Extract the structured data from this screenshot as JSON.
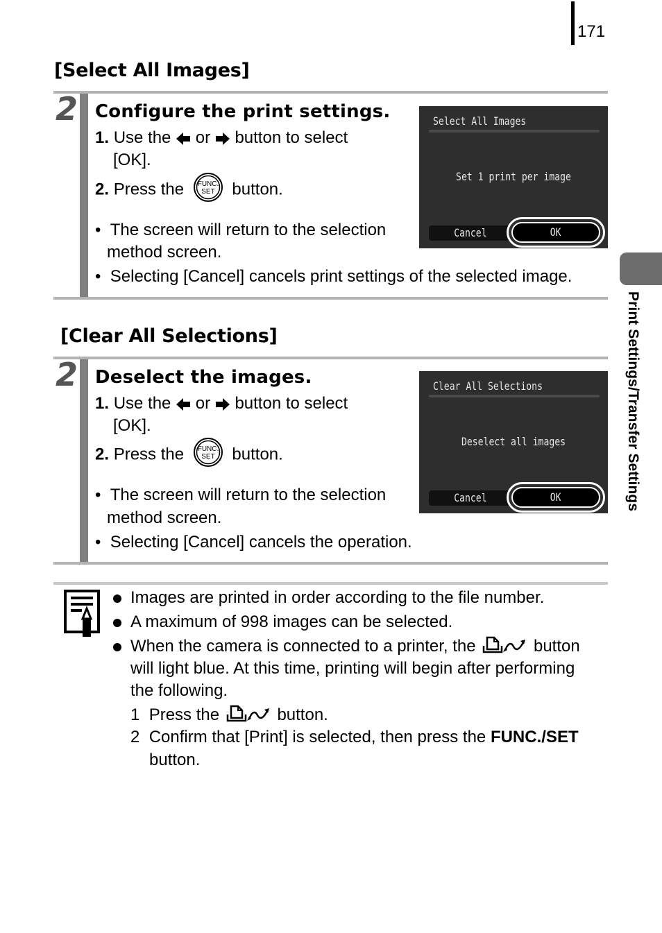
{
  "page_number": "171",
  "side_tab_label": "Print Settings/Transfer Settings",
  "sections": [
    {
      "heading": "[Select All Images]",
      "step_number": "2",
      "step_title": "Configure the print settings.",
      "instr1_num": "1.",
      "instr1_pre": "Use the",
      "instr1_or": "or",
      "instr1_post": "button to select",
      "instr1_cont": "[OK].",
      "instr2_num": "2.",
      "instr2_pre": "Press the",
      "instr2_post": "button.",
      "bullet1_a": "The screen will return to the selection",
      "bullet1_b": "method screen.",
      "bullet2": "Selecting [Cancel] cancels print settings of the selected image.",
      "screen": {
        "title": "Select All Images",
        "message": "Set 1 print per image",
        "cancel_label": "Cancel",
        "ok_label": "OK"
      }
    },
    {
      "heading": "[Clear All Selections]",
      "step_number": "2",
      "step_title": "Deselect the images.",
      "instr1_num": "1.",
      "instr1_pre": "Use the",
      "instr1_or": "or",
      "instr1_post": "button to select",
      "instr1_cont": "[OK].",
      "instr2_num": "2.",
      "instr2_pre": "Press the",
      "instr2_post": "button.",
      "bullet1_a": "The screen will return to the selection",
      "bullet1_b": "method screen.",
      "bullet2": "Selecting [Cancel] cancels the operation.",
      "screen": {
        "title": "Clear All Selections",
        "message": "Deselect all images",
        "cancel_label": "Cancel",
        "ok_label": "OK"
      }
    }
  ],
  "icons": {
    "left_arrow": "left-arrow-button-icon",
    "right_arrow": "right-arrow-button-icon",
    "func_set": "func-set-button-icon",
    "func_set_text_top": "FUNC.",
    "func_set_text_bottom": "SET",
    "print_share": "print-share-button-icon",
    "note": "note-pencil-icon"
  },
  "notes": {
    "bullet1": "Images are printed in order according to the file number.",
    "bullet2": "A maximum of 998 images can be selected.",
    "bullet3_a_pre": "When the camera is connected to a printer, the",
    "bullet3_a_post": "button",
    "bullet3_b": "will light blue. At this time, printing will begin after performing",
    "bullet3_c": "the following.",
    "sub1_num": "1",
    "sub1_pre": "Press the",
    "sub1_post": "button.",
    "sub2_num": "2",
    "sub2_pre": "Confirm that [Print] is selected, then press the",
    "sub2_bold": "FUNC./SET",
    "sub2_cont": "button."
  }
}
